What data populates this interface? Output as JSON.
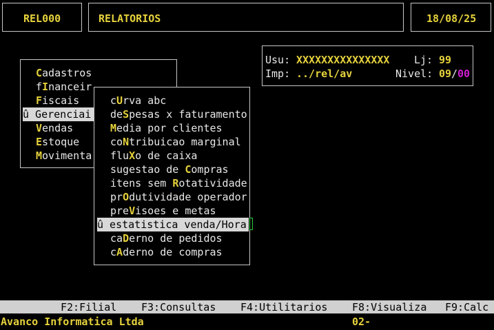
{
  "header": {
    "program_code": "REL000",
    "title": "RELATORIOS",
    "date": "18/08/25"
  },
  "user_panel": {
    "usu_label": "Usu:",
    "usu_value": "XXXXXXXXXXXXXXX",
    "lj_label": "Lj:",
    "lj_value": "99",
    "imp_label": "Imp:",
    "imp_value": "../rel/av",
    "nivel_label": "Nivel:",
    "nivel_a": "09",
    "nivel_sep": "/",
    "nivel_b": "00"
  },
  "main_menu": {
    "items": [
      {
        "pre": "",
        "hot": "C",
        "post": "adastros"
      },
      {
        "pre": "f",
        "hot": "I",
        "post": "nanceir"
      },
      {
        "pre": "",
        "hot": "F",
        "post": "iscais"
      },
      {
        "pre": "û Gerenciai",
        "hot": "",
        "post": ""
      },
      {
        "pre": "",
        "hot": "V",
        "post": "endas"
      },
      {
        "pre": "",
        "hot": "E",
        "post": "stoque"
      },
      {
        "pre": "",
        "hot": "M",
        "post": "ovimenta"
      }
    ]
  },
  "sub_menu": {
    "items": [
      {
        "pre": "c",
        "hot": "U",
        "post": "rva abc"
      },
      {
        "pre": "de",
        "hot": "S",
        "post": "pesas x faturamento"
      },
      {
        "pre": "",
        "hot": "M",
        "post": "edia por clientes"
      },
      {
        "pre": "co",
        "hot": "N",
        "post": "tribuicao marginal"
      },
      {
        "pre": "flu",
        "hot": "X",
        "post": "o de caixa"
      },
      {
        "pre": "sugestao de ",
        "hot": "C",
        "post": "ompras"
      },
      {
        "pre": "itens sem ",
        "hot": "R",
        "post": "otatividade"
      },
      {
        "pre": "pr",
        "hot": "O",
        "post": "dutividade operador"
      },
      {
        "pre": "pre",
        "hot": "V",
        "post": "isoes e metas"
      },
      {
        "pre": "û estatistica venda/Hora",
        "hot": "",
        "post": ""
      },
      {
        "pre": "ca",
        "hot": "D",
        "post": "erno de pedidos"
      },
      {
        "pre": "c",
        "hot": "A",
        "post": "derno de compras"
      }
    ]
  },
  "function_bar": {
    "f2": "F2:Filial",
    "f3": "F3:Consultas",
    "f4": "F4:Utilitarios",
    "f8": "F8:Visualiza",
    "f9": "F9:Calc"
  },
  "status_bar": {
    "company": "Avanco Informatica Ltda",
    "code": "02-"
  }
}
